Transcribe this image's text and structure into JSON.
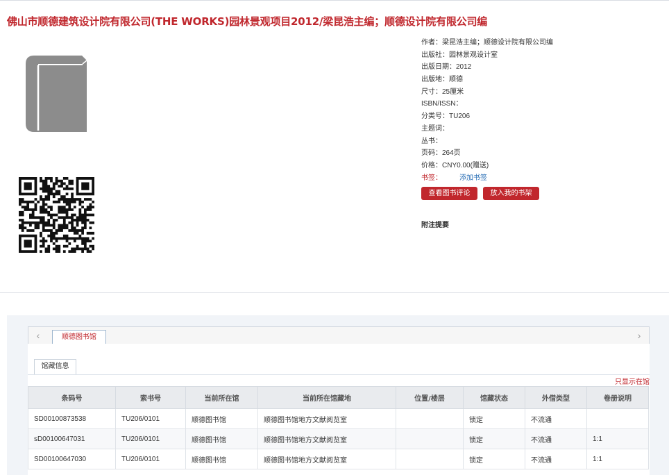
{
  "title": "佛山市顺德建筑设计院有限公司(THE WORKS)园林景观项目2012/梁昆浩主编；顺德设计院有限公司编",
  "meta": [
    "作者：梁昆浩主编；顺德设计院有限公司编",
    "出版社：园林景观设计室",
    "出版日期：2012",
    "出版地：顺德",
    "尺寸：25厘米",
    "ISBN/ISSN：",
    "分类号：TU206",
    "主题词：",
    "丛书：",
    "页码：264页",
    "价格：CNY0.00(赠送)"
  ],
  "bookmark": {
    "label": "书签：",
    "add_link": "添加书签"
  },
  "buttons": {
    "review": "查看图书评论",
    "shelf": "放入我的书架"
  },
  "notes_title": "附注提要",
  "holdings": {
    "library_tab": "顺德图书馆",
    "sub_tab": "馆藏信息",
    "only_show": "只显示在馆",
    "columns": [
      "条码号",
      "索书号",
      "当前所在馆",
      "当前所在馆藏地",
      "位置/楼层",
      "馆藏状态",
      "外借类型",
      "卷册说明"
    ],
    "rows": [
      [
        "SD00100873538",
        "TU206/0101",
        "顺德图书馆",
        "顺德图书馆地方文献阅览室",
        "",
        "锁定",
        "不流通",
        ""
      ],
      [
        "sD00100647031",
        "TU206/0101",
        "顺德图书馆",
        "顺德图书馆地方文献阅览室",
        "",
        "锁定",
        "不流通",
        "1:1"
      ],
      [
        "SD00100647030",
        "TU206/0101",
        "顺德图书馆",
        "顺德图书馆地方文献阅览室",
        "",
        "锁定",
        "不流通",
        "1:1"
      ]
    ]
  },
  "icons": {
    "book": "book-icon",
    "qr": "qr-code",
    "prev": "chevron-left-icon",
    "next": "chevron-right-icon"
  },
  "colors": {
    "accent": "#c0272d",
    "link": "#2a6fb6",
    "book_gray": "#8c8c8c"
  }
}
